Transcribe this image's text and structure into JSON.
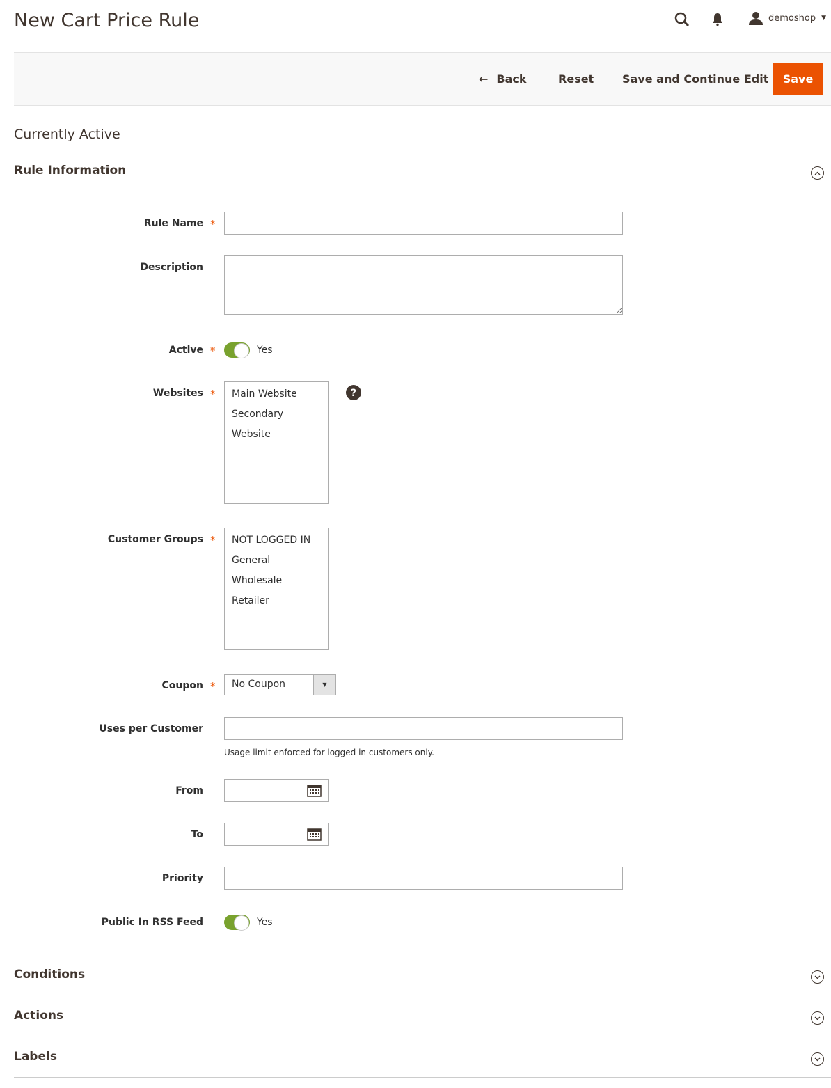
{
  "header": {
    "title": "New Cart Price Rule",
    "user": "demoshop"
  },
  "toolbar": {
    "back": "Back",
    "reset": "Reset",
    "save_continue": "Save and Continue Edit",
    "save": "Save"
  },
  "status": "Currently Active",
  "section": "Rule Information",
  "form": {
    "rule_name": {
      "label": "Rule Name",
      "value": ""
    },
    "description": {
      "label": "Description",
      "value": ""
    },
    "active": {
      "label": "Active",
      "state": "Yes",
      "on": true
    },
    "websites": {
      "label": "Websites",
      "options": [
        "Main Website",
        "Secondary Website"
      ]
    },
    "customer_groups": {
      "label": "Customer Groups",
      "options": [
        "NOT LOGGED IN",
        "General",
        "Wholesale",
        "Retailer"
      ]
    },
    "coupon": {
      "label": "Coupon",
      "value": "No Coupon"
    },
    "uses_per_customer": {
      "label": "Uses per Customer",
      "value": "",
      "note": "Usage limit enforced for logged in customers only."
    },
    "from": {
      "label": "From",
      "value": ""
    },
    "to": {
      "label": "To",
      "value": ""
    },
    "priority": {
      "label": "Priority",
      "value": ""
    },
    "rss": {
      "label": "Public In RSS Feed",
      "state": "Yes",
      "on": true
    }
  },
  "sections": [
    "Conditions",
    "Actions",
    "Labels"
  ],
  "colors": {
    "accent": "#eb5202",
    "toggle_on": "#79a22e"
  }
}
